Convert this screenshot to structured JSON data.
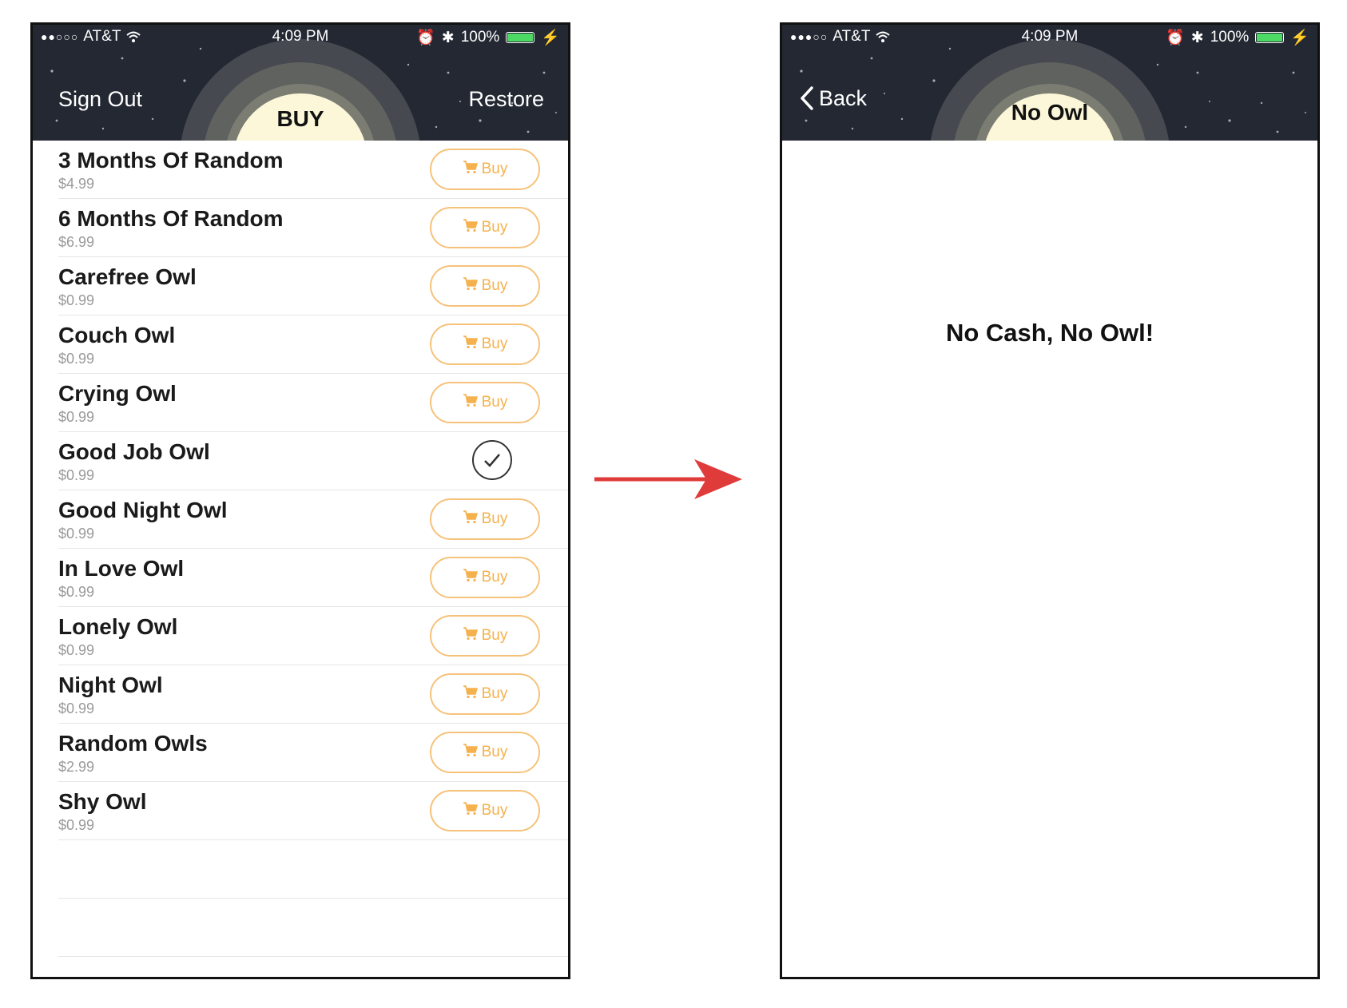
{
  "status_bar": {
    "carrier": "AT&T",
    "time": "4:09 PM",
    "battery": "100%"
  },
  "left_screen": {
    "title": "BUY",
    "nav_left": "Sign Out",
    "nav_right": "Restore",
    "buy_label": "Buy",
    "items": [
      {
        "name": "3 Months Of Random",
        "price": "$4.99",
        "state": "buy"
      },
      {
        "name": "6 Months Of Random",
        "price": "$6.99",
        "state": "buy"
      },
      {
        "name": "Carefree Owl",
        "price": "$0.99",
        "state": "buy"
      },
      {
        "name": "Couch Owl",
        "price": "$0.99",
        "state": "buy"
      },
      {
        "name": "Crying Owl",
        "price": "$0.99",
        "state": "buy"
      },
      {
        "name": "Good Job Owl",
        "price": "$0.99",
        "state": "purchased"
      },
      {
        "name": "Good Night Owl",
        "price": "$0.99",
        "state": "buy"
      },
      {
        "name": "In Love Owl",
        "price": "$0.99",
        "state": "buy"
      },
      {
        "name": "Lonely Owl",
        "price": "$0.99",
        "state": "buy"
      },
      {
        "name": "Night Owl",
        "price": "$0.99",
        "state": "buy"
      },
      {
        "name": "Random Owls",
        "price": "$2.99",
        "state": "buy"
      },
      {
        "name": "Shy Owl",
        "price": "$0.99",
        "state": "buy"
      }
    ]
  },
  "right_screen": {
    "title": "No Owl",
    "back_label": "Back",
    "message": "No Cash, No Owl!"
  },
  "colors": {
    "header_bg": "#232833",
    "button_accent": "#f5b14d",
    "arrow": "#e03b3b",
    "battery": "#4cd964"
  }
}
